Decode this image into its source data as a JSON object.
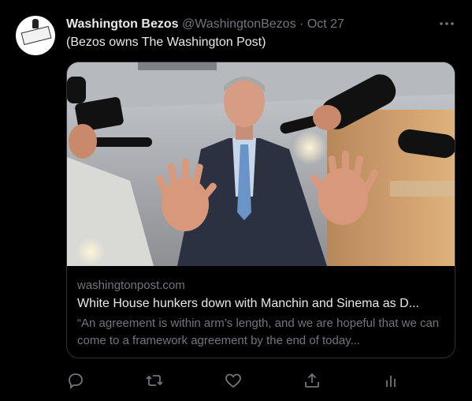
{
  "tweet": {
    "display_name": "Washington Bezos",
    "handle": "@WashingtonBezos",
    "separator": "·",
    "date": "Oct 27",
    "text": "(Bezos owns The Washington Post)",
    "avatar_logo_text": "The Washington Post"
  },
  "card": {
    "image_icon": "politician-press-photo",
    "domain": "washingtonpost.com",
    "title": "White House hunkers down with Manchin and Sinema as D...",
    "description": "“An agreement is within arm’s length, and we are hopeful that we can come to a framework agreement by the end of today..."
  },
  "actions": {
    "reply_icon": "reply-icon",
    "retweet_icon": "retweet-icon",
    "like_icon": "heart-icon",
    "share_icon": "share-icon",
    "analytics_icon": "analytics-icon"
  },
  "colors": {
    "background": "#000000",
    "primary_text": "#e7e9ea",
    "secondary_text": "#71767b",
    "border": "#2f3336"
  }
}
